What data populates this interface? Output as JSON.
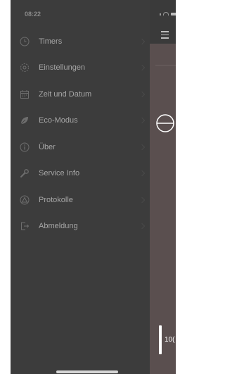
{
  "status_bar": {
    "time": "08:22"
  },
  "menu": {
    "items": [
      {
        "label": "Timers",
        "icon": "clock-icon"
      },
      {
        "label": "Einstellungen",
        "icon": "gear-icon"
      },
      {
        "label": "Zeit und Datum",
        "icon": "calendar-icon"
      },
      {
        "label": "Eco-Modus",
        "icon": "leaf-icon"
      },
      {
        "label": "Über",
        "icon": "info-icon"
      },
      {
        "label": "Service Info",
        "icon": "wrench-icon"
      },
      {
        "label": "Protokolle",
        "icon": "warning-icon"
      },
      {
        "label": "Abmeldung",
        "icon": "logout-icon"
      }
    ]
  },
  "background_screen": {
    "slider_value": "10("
  },
  "colors": {
    "drawer_bg": "#3c3c3c",
    "menu_text": "#a6a6a6",
    "menu_icon": "#6e6e6e",
    "under_panel_bg": "#5a4f4f"
  }
}
